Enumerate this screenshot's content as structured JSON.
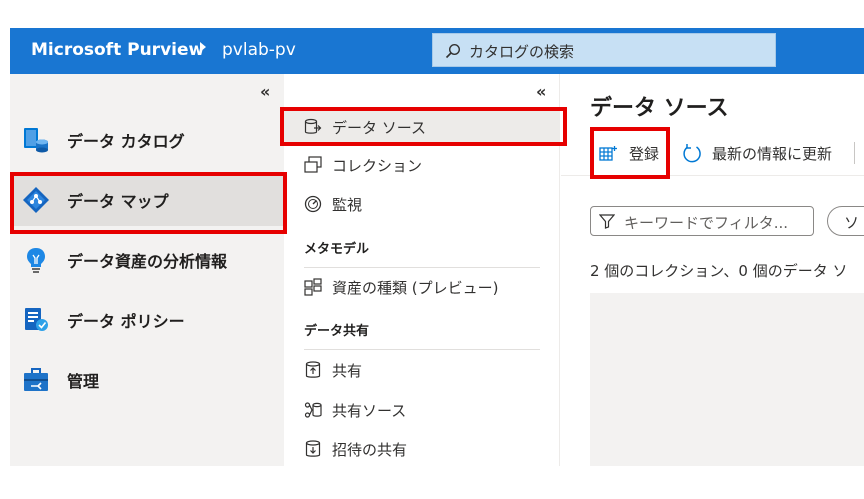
{
  "topbar": {
    "app_title": "Microsoft Purview",
    "account": "pvlab-pv",
    "search_placeholder": "カタログの検索"
  },
  "left_nav": {
    "collapse_glyph": "«",
    "items": [
      {
        "label": "データ カタログ",
        "icon": "data-catalog-icon"
      },
      {
        "label": "データ マップ",
        "icon": "data-map-icon",
        "selected": true
      },
      {
        "label": "データ資産の分析情報",
        "icon": "insights-lightbulb-icon"
      },
      {
        "label": "データ ポリシー",
        "icon": "data-policy-icon"
      },
      {
        "label": "管理",
        "icon": "management-toolbox-icon"
      }
    ]
  },
  "mid_nav": {
    "collapse_glyph": "«",
    "items": [
      {
        "label": "データ ソース",
        "icon": "data-source-icon",
        "selected": true
      },
      {
        "label": "コレクション",
        "icon": "collections-icon"
      },
      {
        "label": "監視",
        "icon": "monitoring-gauge-icon"
      }
    ],
    "metamodel_heading": "メタモデル",
    "metamodel_items": [
      {
        "label": "資産の種類 (プレビュー)",
        "icon": "asset-types-icon"
      }
    ],
    "sharing_heading": "データ共有",
    "sharing_items": [
      {
        "label": "共有",
        "icon": "share-icon"
      },
      {
        "label": "共有ソース",
        "icon": "share-sources-icon"
      },
      {
        "label": "招待の共有",
        "icon": "share-invitations-icon"
      }
    ]
  },
  "main": {
    "title": "データ ソース",
    "toolbar": {
      "register_label": "登録",
      "refresh_label": "最新の情報に更新"
    },
    "filter_placeholder": "キーワードでフィルタ...",
    "pill_label": "ソ",
    "summary": "2 個のコレクション、0 個のデータ ソ"
  },
  "colors": {
    "topbar": "#1976d2",
    "highlight_border": "#e60000",
    "accent": "#0078d4"
  }
}
